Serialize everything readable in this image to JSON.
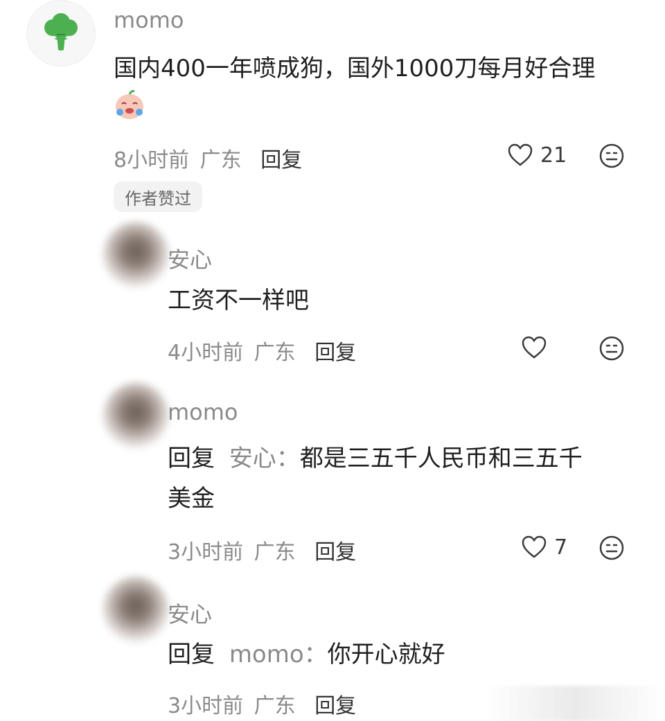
{
  "comments": [
    {
      "author": "momo",
      "text": "国内400一年喷成狗，国外1000刀每月好合理",
      "time": "8小时前",
      "location": "广东",
      "reply_label": "回复",
      "likes": "21",
      "badge": "作者赞过"
    },
    {
      "author": "安心",
      "text": "工资不一样吧",
      "time": "4小时前",
      "location": "广东",
      "reply_label": "回复"
    },
    {
      "author": "momo",
      "reply_prefix": "回复",
      "reply_to": "安心：",
      "text_line1": "都是三五千人民币和三五千",
      "text_line2": "美金",
      "time": "3小时前",
      "location": "广东",
      "reply_label": "回复",
      "likes": "7"
    },
    {
      "author": "安心",
      "reply_prefix": "回复",
      "reply_to": "momo：",
      "text": "你开心就好",
      "time": "3小时前",
      "location": "广东",
      "reply_label": "回复"
    }
  ],
  "icons": {
    "main_avatar": "broccoli-icon",
    "inline_emoji": "crying-laughing-emoji-icon",
    "like": "heart-icon",
    "react": "neutral-face-icon"
  },
  "colors": {
    "broccoli": "#4caf50",
    "muted_text": "#8a8a8a",
    "badge_bg": "#f2f2f2"
  }
}
